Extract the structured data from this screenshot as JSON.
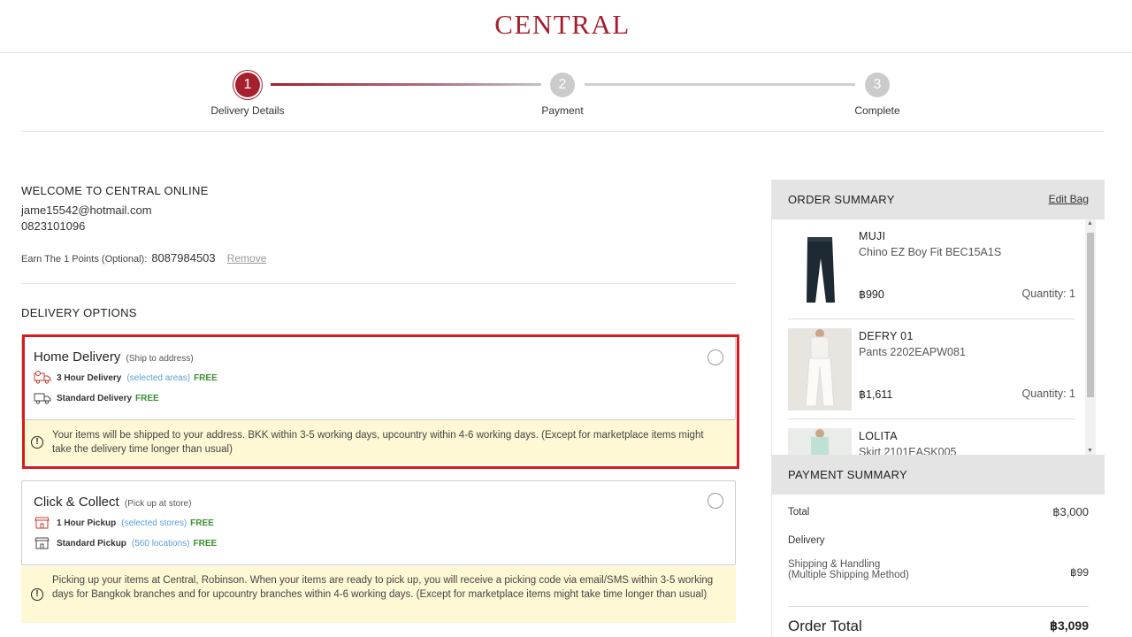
{
  "header": {
    "logo": "CENTRAL"
  },
  "stepper": {
    "steps": [
      {
        "num": "1",
        "label": "Delivery Details",
        "active": true
      },
      {
        "num": "2",
        "label": "Payment",
        "active": false
      },
      {
        "num": "3",
        "label": "Complete",
        "active": false
      }
    ]
  },
  "customer": {
    "welcome": "WELCOME TO CENTRAL ONLINE",
    "email": "jame15542@hotmail.com",
    "phone": "0823101096",
    "points_label": "Earn The 1 Points (Optional):",
    "points_value": "8087984503",
    "remove_label": "Remove"
  },
  "delivery": {
    "title": "DELIVERY OPTIONS",
    "home": {
      "title": "Home Delivery",
      "subtitle": "(Ship to address)",
      "rows": [
        {
          "label": "3 Hour Delivery",
          "note": "(selected areas)",
          "price": "FREE"
        },
        {
          "label": "Standard Delivery",
          "note": "",
          "price": "FREE"
        }
      ],
      "info": "Your items will be shipped to your address. BKK within 3-5 working days, upcountry within 4-6 working days. (Except for marketplace items might take the delivery time longer than usual)"
    },
    "collect": {
      "title": "Click & Collect",
      "subtitle": "(Pick up at store)",
      "rows": [
        {
          "label": "1 Hour Pickup",
          "note": "(selected stores)",
          "price": "FREE"
        },
        {
          "label": "Standard Pickup",
          "note": "(560 locations)",
          "price": "FREE"
        }
      ],
      "info": "Picking up your items at Central, Robinson. When your items are ready to pick up, you will receive a picking code via email/SMS within 3-5 working days for Bangkok branches and for upcountry branches within 4-6 working days. (Except for marketplace items might take time longer than usual)"
    }
  },
  "order_summary": {
    "title": "ORDER SUMMARY",
    "edit_label": "Edit Bag",
    "items": [
      {
        "brand": "MUJI",
        "name": "Chino EZ Boy Fit BEC15A1S",
        "price": "฿990",
        "qty": "Quantity: 1"
      },
      {
        "brand": "DEFRY 01",
        "name": "Pants 2202EAPW081",
        "price": "฿1,611",
        "qty": "Quantity: 1"
      },
      {
        "brand": "LOLITA",
        "name": "Skirt 2101EASK005",
        "price": "",
        "qty": ""
      }
    ]
  },
  "payment_summary": {
    "title": "PAYMENT SUMMARY",
    "total_label": "Total",
    "total_value": "฿3,000",
    "delivery_label": "Delivery",
    "shipping_label": "Shipping & Handling",
    "shipping_sub": "(Multiple Shipping Method)",
    "shipping_value": "฿99",
    "order_total_label": "Order Total",
    "order_total_value": "฿3,099"
  },
  "colors": {
    "brand": "#a61f2e",
    "free": "#3a8f2f",
    "link": "#5aa0d8",
    "info_bg": "#fff8d4",
    "highlight": "#d61c1c"
  }
}
